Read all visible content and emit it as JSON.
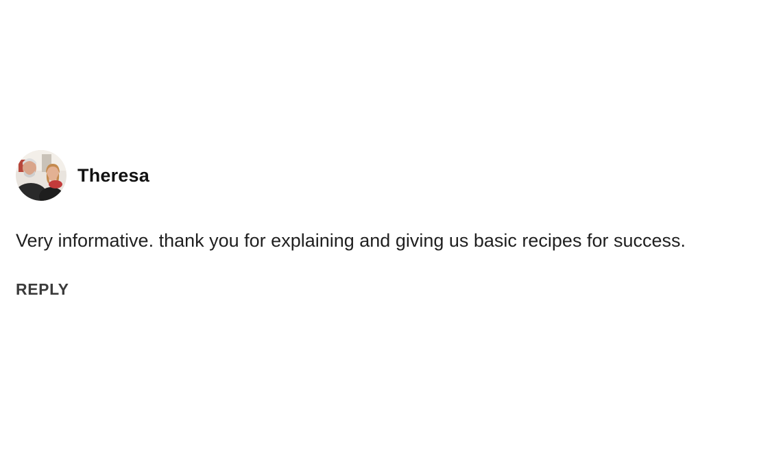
{
  "comment": {
    "author": "Theresa",
    "body": "Very informative. thank you for explaining and giving us basic recipes for success.",
    "reply_label": "REPLY",
    "avatar_icon": "user-photo-avatar"
  },
  "colors": {
    "background": "#ffffff",
    "author_text": "#111111",
    "body_text": "#1f1f1f",
    "reply_text": "#3b3b3b"
  }
}
